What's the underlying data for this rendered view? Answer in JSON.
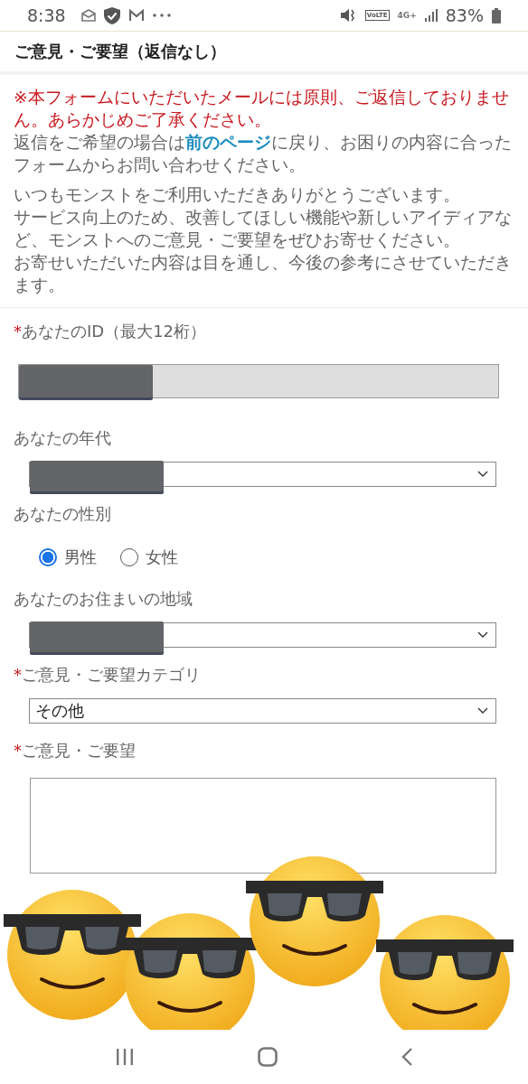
{
  "status_bar": {
    "time": "8:38",
    "volte": "VoLTE",
    "network": "4G+",
    "battery": "83%"
  },
  "header": {
    "title": "ご意見・ご要望（返信なし）"
  },
  "notice": "※本フォームにいただいたメールには原則、ご返信しておりません。あらかじめご了承ください。",
  "reply_info": {
    "before": "返信をご希望の場合は",
    "link": "前のページ",
    "after": "に戻り、お困りの内容に合ったフォームからお問い合わせください。"
  },
  "intro": [
    "いつもモンストをご利用いただきありがとうございます。",
    "サービス向上のため、改善してほしい機能や新しいアイディアなど、モンストへのご意見・ご要望をぜひお寄せください。",
    "お寄せいただいた内容は目を通し、今後の参考にさせていただきます。"
  ],
  "required_mark": "*",
  "fields": [
    {
      "kind": "text",
      "label": "あなたのID（最大12桁）",
      "required": true,
      "redacted": true,
      "disabled": true
    },
    {
      "kind": "select",
      "label": "あなたの年代",
      "required": false,
      "redacted": true
    },
    {
      "kind": "radio",
      "label": "あなたの性別",
      "required": false,
      "options": [
        {
          "label": "男性",
          "selected": true
        },
        {
          "label": "女性",
          "selected": false
        }
      ]
    },
    {
      "kind": "select",
      "label": "あなたのお住まいの地域",
      "required": false,
      "redacted": true
    },
    {
      "kind": "select",
      "label": "ご意見・ご要望カテゴリ",
      "required": true,
      "redacted": false,
      "value": "その他"
    },
    {
      "kind": "textarea",
      "label": "ご意見・ご要望",
      "required": true
    }
  ]
}
